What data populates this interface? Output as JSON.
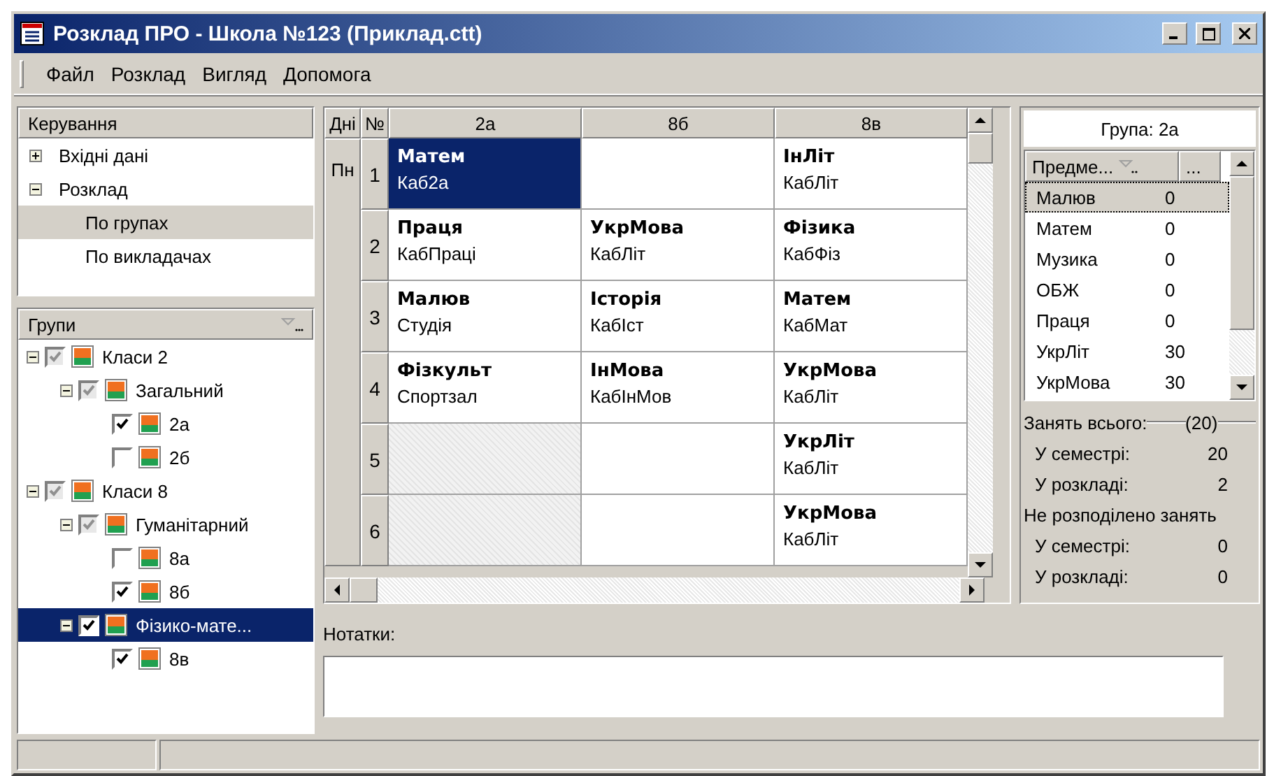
{
  "window": {
    "title": "Розклад ПРО - Школа №123 (Приклад.ctt)"
  },
  "menu": [
    "Файл",
    "Розклад",
    "Вигляд",
    "Допомога"
  ],
  "control_panel": {
    "title": "Керування",
    "items": [
      {
        "label": "Вхідні дані",
        "expanded": false,
        "selected": false
      },
      {
        "label": "Розклад",
        "expanded": true,
        "selected": false,
        "children": [
          {
            "label": "По групах",
            "selected": true
          },
          {
            "label": "По викладачах",
            "selected": false
          }
        ]
      }
    ]
  },
  "groups_panel": {
    "title": "Групи",
    "tree": [
      {
        "label": "Класи 2",
        "checked": true,
        "greyed": true,
        "expanded": true,
        "selected": false,
        "children": [
          {
            "label": "Загальний",
            "checked": true,
            "greyed": true,
            "expanded": true,
            "selected": false,
            "children": [
              {
                "label": "2а",
                "checked": true,
                "greyed": false,
                "selected": false
              },
              {
                "label": "2б",
                "checked": false,
                "greyed": false,
                "selected": false
              }
            ]
          }
        ]
      },
      {
        "label": "Класи 8",
        "checked": true,
        "greyed": true,
        "expanded": true,
        "selected": false,
        "children": [
          {
            "label": "Гуманітарний",
            "checked": true,
            "greyed": true,
            "expanded": true,
            "selected": false,
            "children": [
              {
                "label": "8а",
                "checked": false,
                "greyed": false,
                "selected": false
              },
              {
                "label": "8б",
                "checked": true,
                "greyed": false,
                "selected": false
              }
            ]
          },
          {
            "label": "Фізико-мате...",
            "checked": true,
            "greyed": false,
            "expanded": true,
            "selected": true,
            "children": [
              {
                "label": "8в",
                "checked": true,
                "greyed": false,
                "selected": false
              }
            ]
          }
        ]
      }
    ]
  },
  "schedule": {
    "day_header": "Дні",
    "number_header": "№",
    "columns": [
      "2а",
      "8б",
      "8в"
    ],
    "day": "Пн",
    "rows": [
      {
        "number": "1",
        "cells": [
          {
            "kind": "lesson",
            "subject": "Матем",
            "room": "Каб2а",
            "selected": true
          },
          {
            "kind": "empty",
            "selected": false
          },
          {
            "kind": "lesson",
            "subject": "ІнЛіт",
            "room": "КабЛіт",
            "selected": false
          }
        ]
      },
      {
        "number": "2",
        "cells": [
          {
            "kind": "lesson",
            "subject": "Праця",
            "room": "КабПраці",
            "selected": false
          },
          {
            "kind": "lesson",
            "subject": "УкрМова",
            "room": "КабЛіт",
            "selected": false
          },
          {
            "kind": "lesson",
            "subject": "Фізика",
            "room": "КабФіз",
            "selected": false
          }
        ]
      },
      {
        "number": "3",
        "cells": [
          {
            "kind": "lesson",
            "subject": "Малюв",
            "room": "Студія",
            "selected": false
          },
          {
            "kind": "lesson",
            "subject": "Історія",
            "room": "КабІст",
            "selected": false
          },
          {
            "kind": "lesson",
            "subject": "Матем",
            "room": "КабМат",
            "selected": false
          }
        ]
      },
      {
        "number": "4",
        "cells": [
          {
            "kind": "lesson",
            "subject": "Фізкульт",
            "room": "Спортзал",
            "selected": false
          },
          {
            "kind": "lesson",
            "subject": "ІнМова",
            "room": "КабІнМов",
            "selected": false
          },
          {
            "kind": "lesson",
            "subject": "УкрМова",
            "room": "КабЛіт",
            "selected": false
          }
        ]
      },
      {
        "number": "5",
        "cells": [
          {
            "kind": "blocked",
            "selected": false
          },
          {
            "kind": "empty",
            "selected": false
          },
          {
            "kind": "lesson",
            "subject": "УкрЛіт",
            "room": "КабЛіт",
            "selected": false
          }
        ]
      },
      {
        "number": "6",
        "cells": [
          {
            "kind": "blocked",
            "selected": false
          },
          {
            "kind": "empty",
            "selected": false
          },
          {
            "kind": "lesson",
            "subject": "УкрМова",
            "room": "КабЛіт",
            "selected": false
          }
        ]
      }
    ]
  },
  "group_info": {
    "title": "Група: 2а",
    "columns": [
      "Предме...",
      "..."
    ],
    "rows": [
      {
        "name": "Малюв",
        "count": "0",
        "selected": true
      },
      {
        "name": "Матем",
        "count": "0",
        "selected": false
      },
      {
        "name": "Музика",
        "count": "0",
        "selected": false
      },
      {
        "name": "ОБЖ",
        "count": "0",
        "selected": false
      },
      {
        "name": "Праця",
        "count": "0",
        "selected": false
      },
      {
        "name": "УкрЛіт",
        "count": "30",
        "selected": false
      },
      {
        "name": "УкрМова",
        "count": "30",
        "selected": false
      }
    ],
    "summary": [
      {
        "title": "Занять всього:",
        "badge": "(20)",
        "items": [
          {
            "label": "У семестрі:",
            "value": "20"
          },
          {
            "label": "У розкладі:",
            "value": "2"
          }
        ]
      },
      {
        "title": "Не розподілено занять",
        "items": [
          {
            "label": "У семестрі:",
            "value": "0"
          },
          {
            "label": "У розкладі:",
            "value": "0"
          }
        ]
      }
    ]
  },
  "notes": {
    "label": "Нотатки:"
  }
}
